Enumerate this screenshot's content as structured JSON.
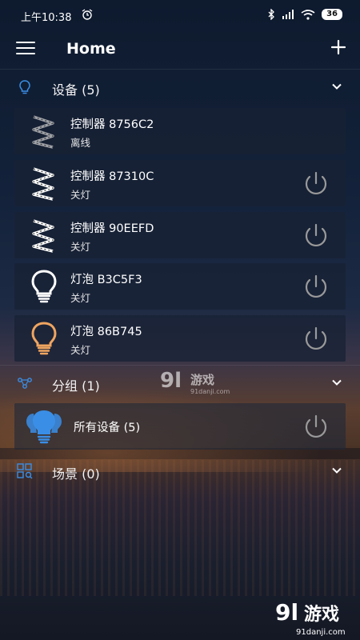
{
  "status_bar": {
    "time": "上午10:38",
    "battery": "36"
  },
  "header": {
    "title": "Home"
  },
  "devices": {
    "title": "设备 (5)",
    "items": [
      {
        "name": "控制器  8756C2",
        "status": "离线",
        "icon": "led-strip-icon",
        "has_power": false
      },
      {
        "name": "控制器  87310C",
        "status": "关灯",
        "icon": "led-strip-icon",
        "has_power": true
      },
      {
        "name": "控制器  90EEFD",
        "status": "关灯",
        "icon": "led-strip-icon",
        "has_power": true
      },
      {
        "name": "灯泡  B3C5F3",
        "status": "关灯",
        "icon": "bulb-icon",
        "has_power": true
      },
      {
        "name": "灯泡  86B745",
        "status": "关灯",
        "icon": "bulb-icon",
        "has_power": true
      }
    ]
  },
  "groups": {
    "title": "分组 (1)",
    "items": [
      {
        "name": "所有设备 (5)",
        "icon": "group-bulb-icon"
      }
    ]
  },
  "scenes": {
    "title": "场景 (0)"
  },
  "watermark": {
    "logo": "9l游戏",
    "site": "91danji.com"
  },
  "colors": {
    "accent_blue": "#3a8ee6",
    "bulb_white": "#ffffff",
    "bulb_orange": "#f0a560",
    "power_gray": "#9a9a9a"
  }
}
